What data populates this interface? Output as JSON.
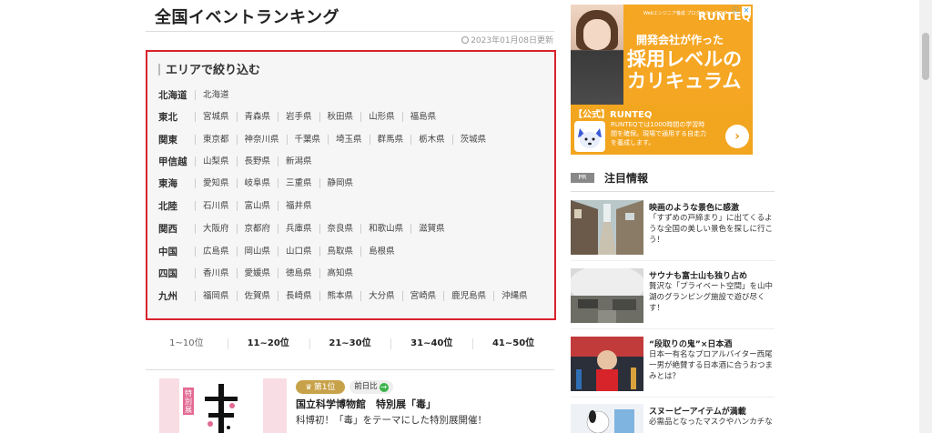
{
  "page": {
    "title": "全国イベントランキング",
    "updated": "2023年01月08日更新"
  },
  "area_filter": {
    "heading": "エリアで絞り込む",
    "regions": [
      {
        "name": "北海道",
        "prefectures": [
          "北海道"
        ]
      },
      {
        "name": "東北",
        "prefectures": [
          "宮城県",
          "青森県",
          "岩手県",
          "秋田県",
          "山形県",
          "福島県"
        ]
      },
      {
        "name": "関東",
        "prefectures": [
          "東京都",
          "神奈川県",
          "千葉県",
          "埼玉県",
          "群馬県",
          "栃木県",
          "茨城県"
        ]
      },
      {
        "name": "甲信越",
        "prefectures": [
          "山梨県",
          "長野県",
          "新潟県"
        ]
      },
      {
        "name": "東海",
        "prefectures": [
          "愛知県",
          "岐阜県",
          "三重県",
          "静岡県"
        ]
      },
      {
        "name": "北陸",
        "prefectures": [
          "石川県",
          "富山県",
          "福井県"
        ]
      },
      {
        "name": "関西",
        "prefectures": [
          "大阪府",
          "京都府",
          "兵庫県",
          "奈良県",
          "和歌山県",
          "滋賀県"
        ]
      },
      {
        "name": "中国",
        "prefectures": [
          "広島県",
          "岡山県",
          "山口県",
          "鳥取県",
          "島根県"
        ]
      },
      {
        "name": "四国",
        "prefectures": [
          "香川県",
          "愛媛県",
          "徳島県",
          "高知県"
        ]
      },
      {
        "name": "九州",
        "prefectures": [
          "福岡県",
          "佐賀県",
          "長崎県",
          "熊本県",
          "大分県",
          "宮崎県",
          "鹿児島県",
          "沖縄県"
        ]
      }
    ]
  },
  "rank_tabs": [
    "1~10位",
    "11~20位",
    "21~30位",
    "31~40位",
    "41~50位"
  ],
  "active_tab": 0,
  "event": {
    "rank": "第1位",
    "compare": "前日比",
    "title": "国立科学博物館　特別展「毒」",
    "description": "科博初！「毒」をテーマにした特別展開催！",
    "thumb_label": "特別展"
  },
  "ad": {
    "small_text": "Webエンジニア養成 プログラミングスクール",
    "logo": "RUNTEQ",
    "line1": "開発会社が作った",
    "line2": "採用レベルの",
    "line3": "カリキュラム",
    "brand": "【公式】RUNTEQ",
    "copy": "RUNTEQでは1000時間の学習時間を確保。現場で通用する自走力を養成します。",
    "go": "›"
  },
  "sidebar": {
    "pr": "PR",
    "heading": "注目情報",
    "items": [
      {
        "title": "映画のような景色に感激",
        "desc": "「すずめの戸締まり」に出てくるような全国の美しい景色を探しに行こう！"
      },
      {
        "title": "サウナも富士山も独り占め",
        "desc": "贅沢な「プライベート空間」を山中湖のグランピング施設で遊び尽くす！"
      },
      {
        "title": "“段取りの鬼”×日本酒",
        "desc": "日本一有名なプロアルバイター西尾一男が絶賛する日本酒に合うおつまみとは？"
      },
      {
        "title": "スヌーピーアイテムが満載",
        "desc": "必需品となったマスクやハンカチな"
      }
    ]
  },
  "colors": {
    "highlight": "#d9232d",
    "gold": "#c8a24a",
    "ad": "#f5a623"
  }
}
